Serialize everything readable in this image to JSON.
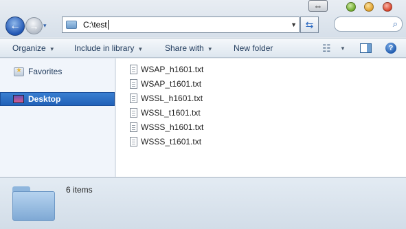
{
  "window": {
    "controls": [
      "green-button",
      "yellow-button",
      "red-button"
    ],
    "resize_glyph": "⇔"
  },
  "nav": {
    "back_glyph": "←",
    "forward_glyph": "→",
    "recent_glyph": "▾"
  },
  "address": {
    "path": "C:\\test",
    "dropdown_glyph": "▼",
    "refresh_glyph": "⇆"
  },
  "search": {
    "placeholder": "",
    "icon_glyph": "⌕"
  },
  "toolbar": {
    "organize_label": "Organize",
    "include_label": "Include in library",
    "share_label": "Share with",
    "newfolder_label": "New folder",
    "dropdown_glyph": "▼",
    "views_glyph": "☷",
    "help_glyph": "?"
  },
  "sidebar": {
    "items": [
      {
        "label": "Favorites",
        "selected": false
      },
      {
        "label": "Desktop",
        "selected": true
      }
    ]
  },
  "files": [
    {
      "name": "WSAP_h1601.txt"
    },
    {
      "name": "WSAP_t1601.txt"
    },
    {
      "name": "WSSL_h1601.txt"
    },
    {
      "name": "WSSL_t1601.txt"
    },
    {
      "name": "WSSS_h1601.txt"
    },
    {
      "name": "WSSS_t1601.txt"
    }
  ],
  "details": {
    "item_count": "6 items"
  },
  "colors": {
    "accent": "#2161b8",
    "pane_bg": "#f1f5fb",
    "details_bg": "#d2dde8"
  }
}
